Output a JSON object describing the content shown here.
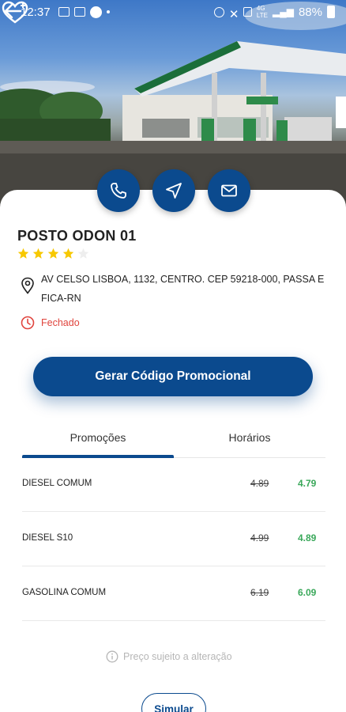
{
  "status_bar": {
    "time": "12:37",
    "battery": "88%"
  },
  "station": {
    "name": "POSTO ODON 01",
    "rating": 4,
    "max_rating": 5,
    "address": "AV CELSO LISBOA, 1132, CENTRO. CEP 59218-000, PASSA E FICA-RN",
    "status": "Fechado"
  },
  "actions": {
    "call_icon": "phone-icon",
    "navigate_icon": "navigation-arrow-icon",
    "email_icon": "mail-icon"
  },
  "promo_button": {
    "label": "Gerar Código Promocional"
  },
  "tabs": [
    {
      "label": "Promoções",
      "active": true
    },
    {
      "label": "Horários",
      "active": false
    }
  ],
  "prices": [
    {
      "fuel": "DIESEL COMUM",
      "old": "4.89",
      "new": "4.79"
    },
    {
      "fuel": "DIESEL S10",
      "old": "4.99",
      "new": "4.89"
    },
    {
      "fuel": "GASOLINA COMUM",
      "old": "6.19",
      "new": "6.09"
    }
  ],
  "notice": "Preço sujeito a alteração",
  "simulate_button": {
    "label": "Simular"
  },
  "colors": {
    "primary": "#0b4a8e",
    "closed": "#e0443d",
    "new_price": "#3aa85a",
    "star": "#f7c800"
  }
}
